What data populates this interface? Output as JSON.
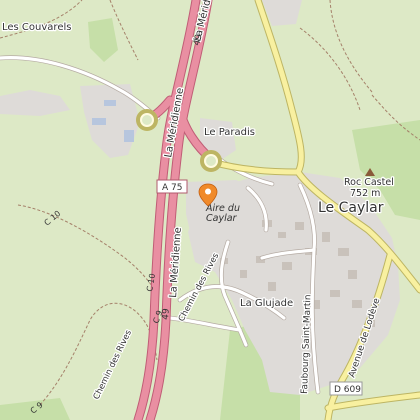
{
  "map": {
    "colors": {
      "background": "#dde9c6",
      "forest": "#c6dfa8",
      "settlement": "#dedbd8",
      "motorway": "#e98fa2",
      "motorway_casing": "#c05d76",
      "secondary_road": "#f8f0a0",
      "secondary_casing": "#bdb563",
      "minor_road": "#ffffff",
      "path": "#a5816a",
      "poi_pin": "#f08a2a"
    },
    "labels": {
      "les_couvarels": "Les Couvarels",
      "motorway_name_north": "La Méridienne",
      "motorway_name_south": "La Méridienne",
      "motorway_ref_north": "49",
      "motorway_ref_south": "49",
      "le_paradis": "Le Paradis",
      "a75": "A 75",
      "aire_du_caylar_line1": "Aire du",
      "aire_du_caylar_line2": "Caylar",
      "roc_castel": "Roc Castel",
      "roc_castel_elevation": "752 m",
      "le_caylar": "Le Caylar",
      "c10_north": "C 10",
      "c10_west": "C 10",
      "la_glujade": "La Glujade",
      "chemin_des_rives_north": "Chemin des Rives",
      "chemin_des_rives_south": "Chemin des Rives",
      "c9_north": "C 9",
      "c9_south": "C 9",
      "faubourg_saint_martin": "Faubourg Saint-Martin",
      "avenue_de_lodeve": "Avenue de Lodève",
      "d609": "D 609"
    },
    "poi": {
      "icon": "location-pin-icon"
    }
  }
}
